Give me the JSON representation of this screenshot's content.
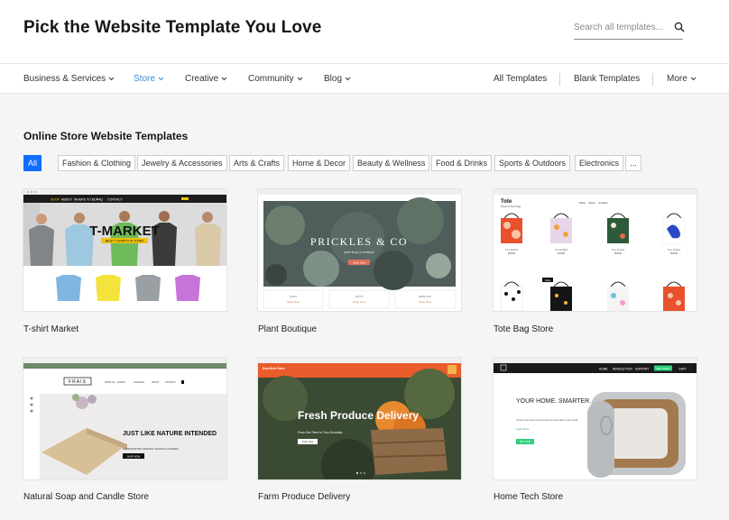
{
  "header": {
    "title": "Pick the Website Template You Love",
    "search_placeholder": "Search all templates..."
  },
  "nav": {
    "left": [
      {
        "label": "Business & Services"
      },
      {
        "label": "Store"
      },
      {
        "label": "Creative"
      },
      {
        "label": "Community"
      },
      {
        "label": "Blog"
      }
    ],
    "right": [
      {
        "label": "All Templates"
      },
      {
        "label": "Blank Templates"
      },
      {
        "label": "More"
      }
    ],
    "active": "Store",
    "accent_color": "#3b8ed6"
  },
  "section": {
    "title": "Online Store Website Templates",
    "filters": [
      {
        "label": "All"
      },
      {
        "label": "Fashion & Clothing"
      },
      {
        "label": "Jewelry & Accessories"
      },
      {
        "label": "Arts & Crafts"
      },
      {
        "label": "Home & Decor"
      },
      {
        "label": "Beauty & Wellness"
      },
      {
        "label": "Food & Drinks"
      },
      {
        "label": "Sports & Outdoors"
      },
      {
        "label": "Electronics"
      },
      {
        "label": "..."
      }
    ],
    "active_filter": "All",
    "active_filter_color": "#116dff"
  },
  "templates": [
    {
      "name": "T-shirt Market",
      "preview": {
        "nav": [
          "SHOP",
          "ABOUT",
          "WHERE TO BUY",
          "FAQ",
          "CONTACT"
        ],
        "headline": "T-MARKET",
        "tagline": "BEST T-SHIRTS IN TOWN"
      }
    },
    {
      "name": "Plant Boutique",
      "preview": {
        "logo": "PRICKLES & CO",
        "cta": "Shop Now",
        "subtitle": "plant shop & boutique",
        "tiles": [
          "SHOP",
          "GIFTS",
          "DESIGNS"
        ],
        "tile_link": "Shop Now"
      }
    },
    {
      "name": "Tote Bag Store",
      "preview": {
        "logo": "Tote",
        "logo_sub": "Playful Printed Bags",
        "nav": [
          "Shop",
          "About",
          "Contact"
        ],
        "item_label": "I'm a product",
        "price": "$19.99",
        "sale_badge": "SALE"
      }
    },
    {
      "name": "Natural Soap and Candle Store",
      "preview": {
        "logo": "FRAIS",
        "nav": [
          "SHOP ALL",
          "SOAPS",
          "CANDLES",
          "ABOUT",
          "CONTACT"
        ],
        "headline": "JUST LIKE NATURE INTENDED",
        "subtitle": "HANDCRAFTED ORGANIC SOAPS & CANDLES",
        "cta": "SHOP NOW"
      }
    },
    {
      "name": "Farm Produce Delivery",
      "preview": {
        "logo": "Deerfield Farm",
        "headline": "Fresh Produce Delivery",
        "subtitle": "From Our Farm to Your Doorstep",
        "cta": "Order Now"
      }
    },
    {
      "name": "Home Tech Store",
      "preview": {
        "nav": [
          "HOME",
          "NEWSLETTER",
          "SUPPORT",
          "BUY NOW",
          "CART"
        ],
        "headline": "YOUR HOME. SMARTER.",
        "body": "Control your home environment from the palm of your hand!",
        "link": "Learn More",
        "cta": "BUY NOW"
      }
    }
  ]
}
